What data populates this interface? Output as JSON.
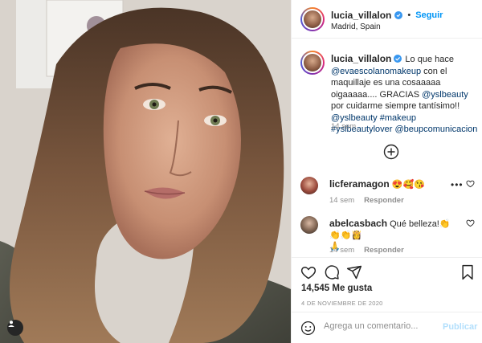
{
  "post": {
    "username": "lucia_villalon",
    "location": "Madrid, Spain",
    "follow_label": "Seguir",
    "separator": "•"
  },
  "caption": {
    "username": "lucia_villalon",
    "text_intro": " Lo que hace ",
    "mention_1": "@evaescolanomakeup",
    "text_mid_1": " con el maquillaje es una cosaaaaa oigaaaaa.... GRACIAS ",
    "mention_2": "@yslbeauty",
    "text_mid_2": " por cuidarme siempre tantísimo!! ",
    "mention_3": "@yslbeauty",
    "sp1": " ",
    "tag_1": "#makeup",
    "sp2": " ",
    "tag_2": "#yslbeautylover",
    "sp3": " ",
    "mention_4": "@beupcomunicacion",
    "time": "14 sem"
  },
  "comments": [
    {
      "username": "licferamagon",
      "text": " 😍🥰😘",
      "time": "14 sem",
      "reply_label": "Responder",
      "more": "•••"
    },
    {
      "username": "abelcasbach",
      "text": " Qué belleza!👏👏👏👸",
      "text2": "🙏",
      "time": "14 sem",
      "reply_label": "Responder"
    }
  ],
  "actions": {
    "likes": "14,545 Me gusta",
    "date": "4 DE NOVIEMBRE DE 2020"
  },
  "comment_box": {
    "placeholder": "Agrega un comentario...",
    "post_label": "Publicar"
  },
  "colors": {
    "link": "#00376b",
    "accent": "#0095f6",
    "muted": "#8e8e8e",
    "verified": "#3897f0"
  }
}
